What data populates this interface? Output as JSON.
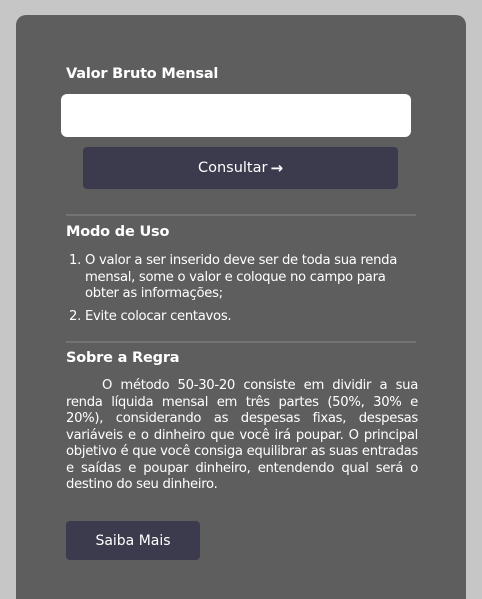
{
  "form": {
    "label": "Valor Bruto Mensal",
    "input_value": "",
    "input_placeholder": "",
    "consult_label": "Consultar",
    "consult_icon": "arrow-right-icon"
  },
  "usage": {
    "title": "Modo de Uso",
    "items": [
      {
        "num": "1.",
        "text": "O valor a ser inserido deve ser de toda sua renda mensal, some o valor e coloque no campo para obter as informações;"
      },
      {
        "num": "2.",
        "text": "Evite colocar centavos."
      }
    ]
  },
  "rule": {
    "title": "Sobre a Regra",
    "text": "O método 50-30-20 consiste em dividir a sua renda líquida mensal em três partes (50%, 30% e 20%), considerando as despesas fixas, despesas variáveis e o dinheiro que você irá poupar. O principal objetivo é que você consiga equilibrar as suas entradas e saídas e poupar dinheiro, entendendo qual será o destino do seu dinheiro.",
    "more_label": "Saiba Mais"
  },
  "colors": {
    "background": "#c6c6c6",
    "card": "#5e5e5e",
    "button": "#3b3b4d",
    "text": "#ffffff"
  }
}
